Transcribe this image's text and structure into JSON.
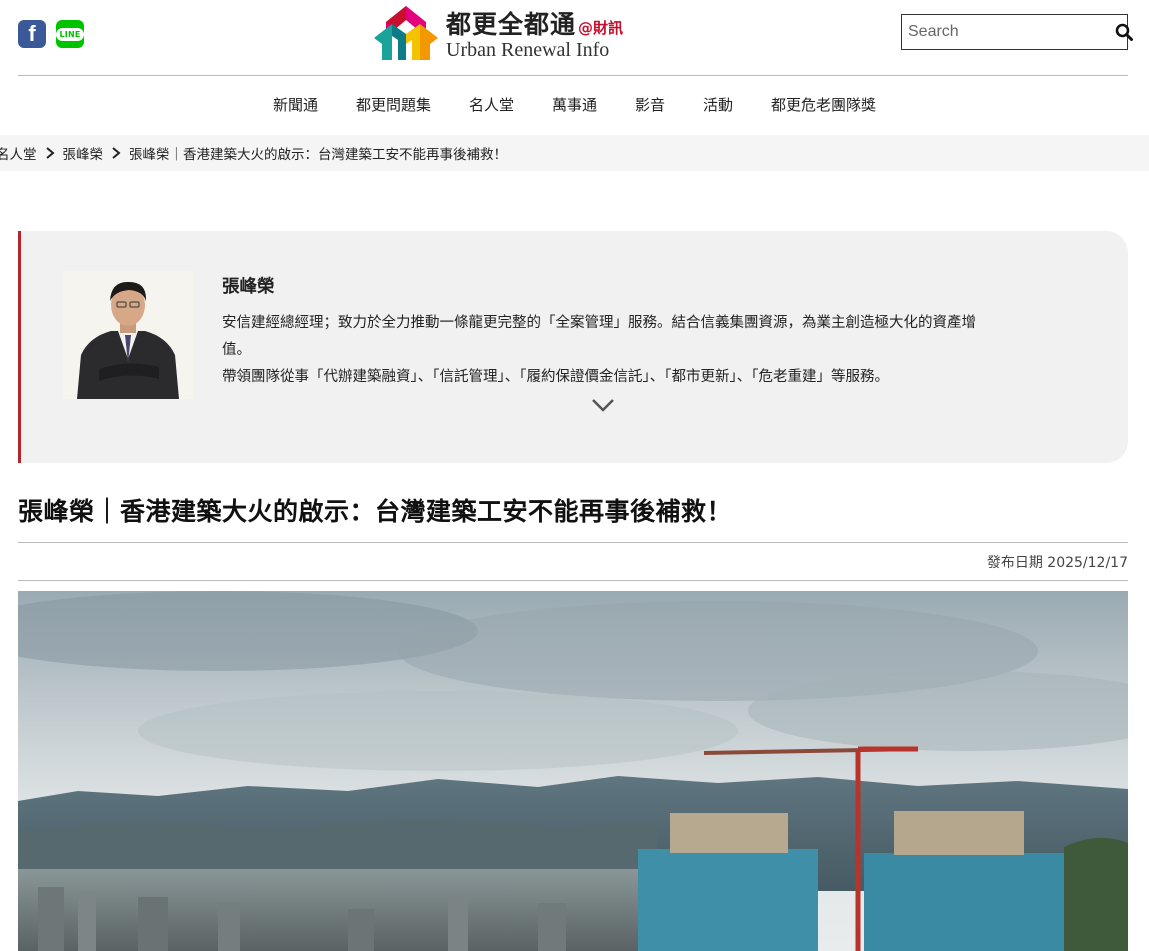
{
  "header": {
    "logo_cn": "都更全都通",
    "logo_tag": "@財訊",
    "logo_en": "Urban Renewal Info",
    "search_placeholder": "Search",
    "line_label": "LINE"
  },
  "nav": [
    "新聞通",
    "都更問題集",
    "名人堂",
    "萬事通",
    "影音",
    "活動",
    "都更危老團隊獎"
  ],
  "breadcrumb": [
    "名人堂",
    "張峰榮",
    "張峰榮｜香港建築大火的啟示：台灣建築工安不能再事後補救！"
  ],
  "author": {
    "name": "張峰榮",
    "bio_1": "安信建經總經理；致力於全力推動一條龍更完整的「全案管理」服務。結合信義集團資源，為業主創造極大化的資產增值。",
    "bio_2": "帶領團隊從事「代辦建築融資」、「信託管理」、「履約保證價金信託」、「都市更新」、「危老重建」等服務。"
  },
  "article": {
    "title": "張峰榮｜香港建築大火的啟示：台灣建築工安不能再事後補救！",
    "date_label": "發布日期",
    "date": "2025/12/17"
  },
  "colors": {
    "accent": "#b3262f",
    "facebook": "#3b5998",
    "line": "#00c300"
  }
}
